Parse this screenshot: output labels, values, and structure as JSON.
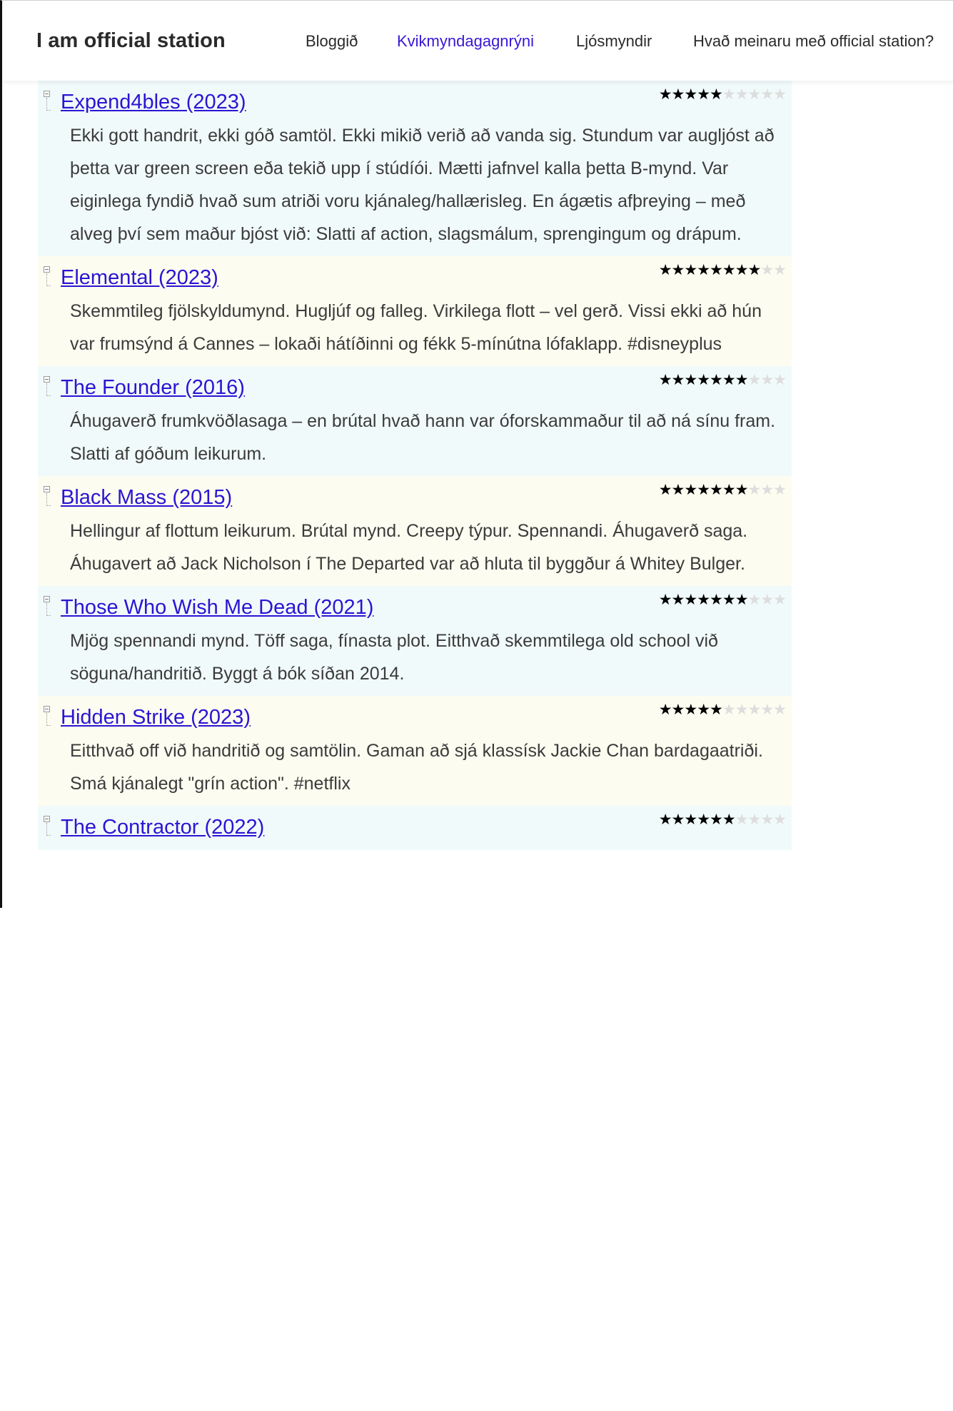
{
  "site": {
    "title": "I am official station"
  },
  "nav": [
    {
      "label": "Bloggið",
      "active": false
    },
    {
      "label": "Kvikmyndagagnrýni",
      "active": true
    },
    {
      "label": "Ljósmyndir",
      "active": false
    },
    {
      "label": "Hvað meinaru með official station?",
      "active": false
    }
  ],
  "colors": {
    "active_nav": "#3a16d6",
    "link": "#2a15d4",
    "row_tone_a": "#f1fafa",
    "row_tone_b": "#fcfcf0"
  },
  "icons": {
    "tree_toggle": "tree-collapse-icon",
    "rating": "star-icon"
  },
  "rating_scale": 10,
  "reviews": [
    {
      "title": "Expend4bles (2023)",
      "rating": 5,
      "text": "Ekki gott handrit, ekki góð samtöl. Ekki mikið verið að vanda sig. Stundum var augljóst að þetta var green screen eða tekið upp í stúdíói. Mætti jafnvel kalla þetta B-mynd. Var eiginlega fyndið hvað sum atriði voru kjánaleg/hallærisleg. En ágætis afþreying – með alveg því sem maður bjóst við: Slatti af action, slagsmálum, sprengingum og drápum."
    },
    {
      "title": "Elemental (2023)",
      "rating": 8,
      "text": "Skemmtileg fjölskyldumynd. Hugljúf og falleg. Virkilega flott – vel gerð. Vissi ekki að hún var frumsýnd á Cannes – lokaði hátíðinni og fékk 5-mínútna lófaklapp. #disneyplus"
    },
    {
      "title": "The Founder (2016)",
      "rating": 7,
      "text": "Áhugaverð frumkvöðlasaga – en brútal hvað hann var óforskammaður til að ná sínu fram. Slatti af góðum leikurum."
    },
    {
      "title": "Black Mass (2015)",
      "rating": 7,
      "text": "Hellingur af flottum leikurum. Brútal mynd. Creepy týpur. Spennandi. Áhugaverð saga. Áhugavert að Jack Nicholson í The Departed var að hluta til byggður á Whitey Bulger."
    },
    {
      "title": "Those Who Wish Me Dead (2021)",
      "rating": 7,
      "text": "Mjög spennandi mynd. Töff saga, fínasta plot. Eitthvað skemmtilega old school við söguna/handritið. Byggt á bók síðan 2014."
    },
    {
      "title": "Hidden Strike (2023)",
      "rating": 5,
      "text": "Eitthvað off við handritið og samtölin. Gaman að sjá klassísk Jackie Chan bardagaatriði. Smá kjánalegt \"grín action\". #netflix"
    },
    {
      "title": "The Contractor (2022)",
      "rating": 6,
      "text": ""
    }
  ]
}
